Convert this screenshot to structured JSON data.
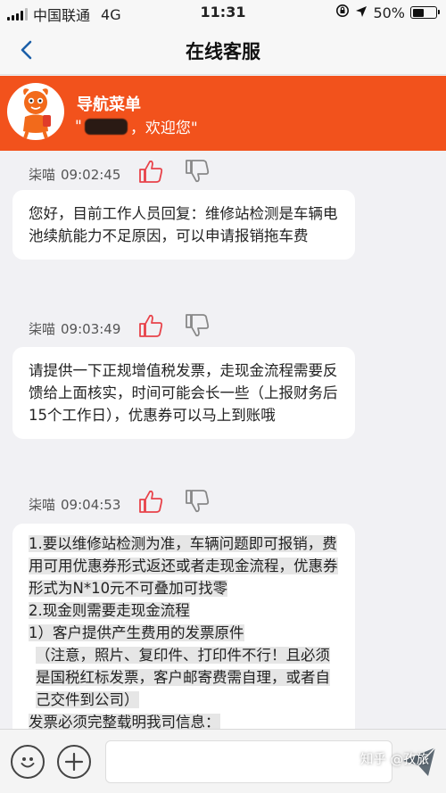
{
  "status_bar": {
    "carrier": "中国联通",
    "network": "4G",
    "time": "11:31",
    "battery": "50%",
    "battery_level": 0.5
  },
  "nav": {
    "title": "在线客服"
  },
  "banner": {
    "title": "导航菜单",
    "welcome_prefix": "\"",
    "welcome_suffix": "，欢迎您\""
  },
  "messages": [
    {
      "sender": "柒喵",
      "time": "09:02:45",
      "paragraphs": [
        "您好，目前工作人员回复：维修站检测是车辆电池续航能力不足原因，可以申请报销拖车费"
      ]
    },
    {
      "sender": "柒喵",
      "time": "09:03:49",
      "paragraphs": [
        "请提供一下正规增值税发票，走现金流程需要反馈给上面核实，时间可能会长一些（上报财务后15个工作日），优惠券可以马上到账哦"
      ]
    },
    {
      "sender": "柒喵",
      "time": "09:04:53",
      "paragraphs": [
        "1.要以维修站检测为准，车辆问题即可报销，费用可用优惠券形式返还或者走现金流程，优惠券形式为N*10元不可叠加可找零",
        "2.现金则需要走现金流程",
        "1）客户提供产生费用的发票原件",
        "（注意，照片、复印件、打印件不行！且必须是国税红标发票，客户邮寄费需自理，或者自己交件到公司）",
        "发票必须完整载明我司信息："
      ]
    }
  ],
  "colors": {
    "accent": "#f2521c",
    "thumb_up": "#e8434a",
    "thumb_down": "#888888"
  },
  "icons": {
    "back": "chevron-left-icon",
    "like": "thumbs-up-icon",
    "dislike": "thumbs-down-icon",
    "emoji": "smiley-icon",
    "add": "plus-icon",
    "send": "paper-plane-icon"
  },
  "watermark": "知乎 @孜旅"
}
